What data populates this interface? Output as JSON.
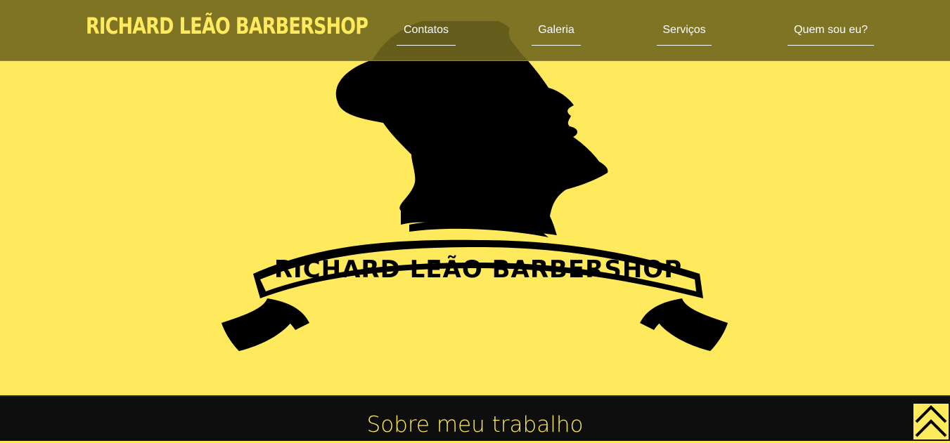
{
  "header": {
    "brand": "RICHARD LEÃO BARBERSHOP",
    "nav": [
      {
        "label": "Contatos"
      },
      {
        "label": "Galeria"
      },
      {
        "label": "Serviços"
      },
      {
        "label": "Quem sou eu?"
      }
    ]
  },
  "hero": {
    "logo_text": "RICHARD LEÃO BARBERSHOP",
    "logo_icon": "barber-silhouette-icon",
    "background_color": "#ffe95c"
  },
  "about": {
    "title": "Sobre meu trabalho"
  },
  "back_to_top": {
    "icon": "double-chevron-up-icon"
  },
  "colors": {
    "accent": "#ffe95c",
    "navbar": "#70671e",
    "dark": "#0e0e0e"
  }
}
